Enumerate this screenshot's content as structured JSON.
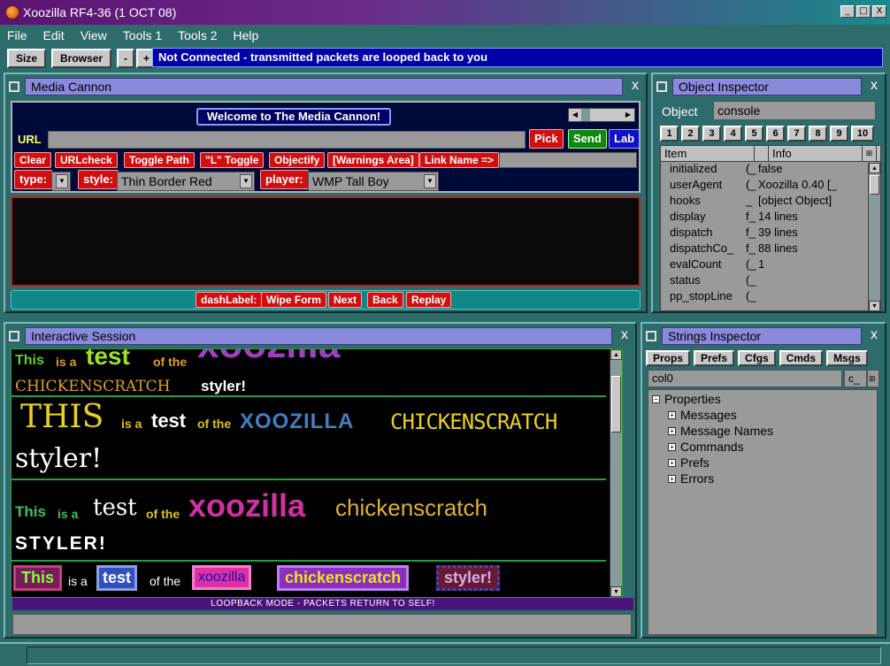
{
  "window": {
    "title": "Xoozilla RF4-36 (1 OCT 08)",
    "min": "_",
    "max": "□",
    "close": "X"
  },
  "menu": [
    "File",
    "Edit",
    "View",
    "Tools 1",
    "Tools 2",
    "Help"
  ],
  "toolbar": {
    "size": "Size",
    "browser": "Browser",
    "minus": "-",
    "plus": "+",
    "status": "Not Connected - transmitted packets are looped back to you"
  },
  "media_cannon": {
    "title": "Media Cannon",
    "close": "x",
    "welcome": "Welcome to The Media Cannon!",
    "url_label": "URL",
    "pick": "Pick",
    "send": "Send",
    "lab": "Lab",
    "buttons": [
      "Clear",
      "URLcheck",
      "Toggle Path",
      "\"L\" Toggle",
      "Objectify",
      "[Warnings Area]",
      "Link Name =>"
    ],
    "type_label": "type:",
    "style_label": "style:",
    "style_value": "Thin Border Red",
    "player_label": "player:",
    "player_value": "WMP Tall Boy",
    "bottom_buttons": [
      "dashLabel:",
      "Wipe Form",
      "Next",
      "Back",
      "Replay"
    ]
  },
  "object_inspector": {
    "title": "Object Inspector",
    "close": "x",
    "object_label": "Object",
    "object_value": "console",
    "tabs": [
      "1",
      "2",
      "3",
      "4",
      "5",
      "6",
      "7",
      "8",
      "9",
      "10"
    ],
    "col_item": "Item",
    "col_info": "Info",
    "rows": [
      {
        "name": "initialized",
        "type": "(_",
        "value": "false"
      },
      {
        "name": "userAgent",
        "type": "(_",
        "value": "Xoozilla 0.40 [_"
      },
      {
        "name": "hooks",
        "type": "_",
        "value": "[object Object]"
      },
      {
        "name": "display",
        "type": "f_",
        "value": "14 lines"
      },
      {
        "name": "dispatch",
        "type": "f_",
        "value": "39 lines"
      },
      {
        "name": "dispatchCo_",
        "type": "f_",
        "value": "88 lines"
      },
      {
        "name": "evalCount",
        "type": "(_",
        "value": "1"
      },
      {
        "name": "status",
        "type": "(_",
        "value": ""
      },
      {
        "name": "pp_stopLine",
        "type": "(_",
        "value": ""
      }
    ]
  },
  "interactive_session": {
    "title": "Interactive Session",
    "close": "x",
    "s1": {
      "w1": "This",
      "w2": "is a",
      "w3": "test",
      "w4": "of the",
      "w5": "xoozilla",
      "w6": "CHICKENSCRATCH",
      "w7": "styler!"
    },
    "s2": {
      "w1": "THIS",
      "w2": "is a",
      "w3": "test",
      "w4": "of the",
      "w5": "XOOZILLA",
      "w6": "CHICKENSCRATCH",
      "w7": "styler!"
    },
    "s3": {
      "w1": "This",
      "w2": "is a",
      "w3": "test",
      "w4": "of the",
      "w5": "xoozilla",
      "w6": "chickenscratch",
      "w7": "STYLER!"
    },
    "s4": {
      "w1": "This",
      "w2": "is a",
      "w3": "test",
      "w4": "of the",
      "w5": "xoozilla",
      "w6": "chickenscratch",
      "w7": "styler!"
    },
    "loopback": "LOOPBACK MODE - PACKETS RETURN TO SELF!"
  },
  "strings_inspector": {
    "title": "Strings Inspector",
    "close": "x",
    "buttons": [
      "Props",
      "Prefs",
      "Cfgs",
      "Cmds",
      "Msgs"
    ],
    "col_value": "col0",
    "col_short": "c_",
    "root": "Properties",
    "children": [
      "Messages",
      "Message Names",
      "Commands",
      "Prefs",
      "Errors"
    ]
  }
}
